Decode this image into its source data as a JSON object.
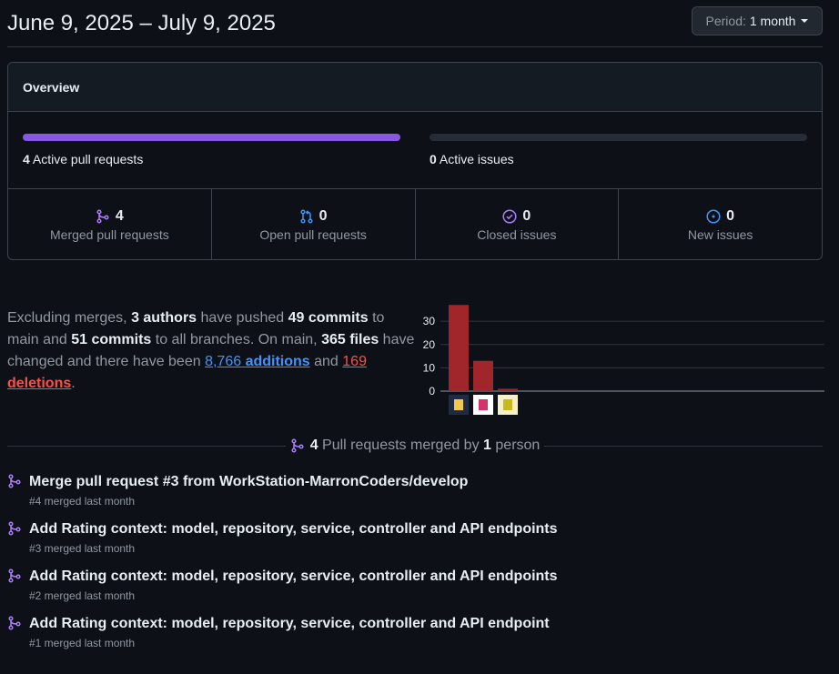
{
  "header": {
    "date_range": "June 9, 2025 – July 9, 2025",
    "period_label": "Period:",
    "period_value": "1 month"
  },
  "overview": {
    "title": "Overview",
    "active_prs_count": "4",
    "active_prs_label": "Active pull requests",
    "active_prs_fill": 1.0,
    "active_issues_count": "0",
    "active_issues_label": "Active issues",
    "active_issues_fill": 0.0,
    "stats": [
      {
        "count": "4",
        "label": "Merged pull requests",
        "icon": "merge-icon",
        "color": "#ab7df8"
      },
      {
        "count": "0",
        "label": "Open pull requests",
        "icon": "pull-request-icon",
        "color": "#4493f8"
      },
      {
        "count": "0",
        "label": "Closed issues",
        "icon": "issue-closed-icon",
        "color": "#ab7df8"
      },
      {
        "count": "0",
        "label": "New issues",
        "icon": "issue-open-icon",
        "color": "#4493f8"
      }
    ]
  },
  "summary": {
    "t1": "Excluding merges, ",
    "authors": "3 authors",
    "t2": " have pushed ",
    "main_commits": "49 commits",
    "t3": " to main and ",
    "all_commits": "51 commits",
    "t4": " to all branches. On main, ",
    "files": "365 files",
    "t5": " have changed and there have been ",
    "additions_num": "8,766",
    "additions_word": "additions",
    "t6": " and ",
    "deletions_num": "169",
    "deletions_word": "deletions",
    "t7": "."
  },
  "chart_data": {
    "type": "bar",
    "categories": [
      "author-1",
      "author-2",
      "author-3"
    ],
    "values": [
      37,
      13,
      1
    ],
    "ylim": [
      0,
      40
    ],
    "yticks": [
      0,
      10,
      20,
      30
    ],
    "bar_color": "#a1262b",
    "grid": true
  },
  "merged_divider": {
    "count": "4",
    "text": "Pull requests merged by",
    "people_count": "1",
    "people_word": "person"
  },
  "pull_requests": [
    {
      "title": "Merge pull request #3 from WorkStation-MarronCoders/develop",
      "meta": "#4 merged last month"
    },
    {
      "title": "Add Rating context: model, repository, service, controller and API endpoints",
      "meta": "#3 merged last month"
    },
    {
      "title": "Add Rating context: model, repository, service, controller and API endpoints",
      "meta": "#2 merged last month"
    },
    {
      "title": "Add Rating context: model, repository, service, controller and API endpoint",
      "meta": "#1 merged last month"
    }
  ],
  "colors": {
    "accent_purple": "#8957e5",
    "link_blue": "#4493f8",
    "deletion_red": "#f85149"
  }
}
